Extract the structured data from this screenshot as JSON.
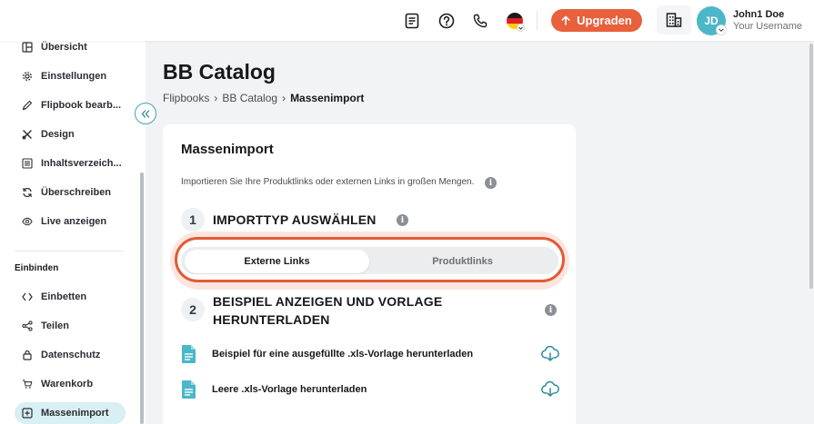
{
  "topbar": {
    "icons": [
      "document-icon",
      "help-icon",
      "phone-icon",
      "german-flag-icon"
    ],
    "upgrade_label": "Upgraden",
    "user": {
      "initials": "JD",
      "name": "John1 Doe",
      "subtitle": "Your Username"
    }
  },
  "sidebar": {
    "items": [
      {
        "label": "Übersicht",
        "icon": "overview-icon"
      },
      {
        "label": "Einstellungen",
        "icon": "gear-icon"
      },
      {
        "label": "Flipbook bearb...",
        "icon": "pencil-icon"
      },
      {
        "label": "Design",
        "icon": "design-icon"
      },
      {
        "label": "Inhaltsverzeich...",
        "icon": "list-icon"
      },
      {
        "label": "Überschreiben",
        "icon": "refresh-icon"
      },
      {
        "label": "Live anzeigen",
        "icon": "eye-icon"
      }
    ],
    "section_label": "Einbinden",
    "embed_items": [
      {
        "label": "Einbetten",
        "icon": "code-icon"
      },
      {
        "label": "Teilen",
        "icon": "share-icon"
      },
      {
        "label": "Datenschutz",
        "icon": "lock-icon"
      },
      {
        "label": "Warenkorb",
        "icon": "cart-icon"
      },
      {
        "label": "Massenimport",
        "icon": "import-icon",
        "active": true
      }
    ]
  },
  "page": {
    "title": "BB Catalog",
    "breadcrumb": [
      "Flipbooks",
      "BB Catalog",
      "Massenimport"
    ]
  },
  "card": {
    "title": "Massenimport",
    "description": "Importieren Sie Ihre Produktlinks oder externen Links in großen Mengen.",
    "step1": {
      "number": "1",
      "title": "IMPORTTYP AUSWÄHLEN"
    },
    "toggle": {
      "options": [
        "Externe Links",
        "Produktlinks"
      ],
      "selected": "Externe Links"
    },
    "step2": {
      "number": "2",
      "title_line1": "BEISPIEL ANZEIGEN UND VORLAGE",
      "title_line2": "HERUNTERLADEN"
    },
    "downloads": [
      {
        "label": "Beispiel für eine ausgefüllte .xls-Vorlage herunterladen"
      },
      {
        "label": "Leere .xls-Vorlage herunterladen"
      }
    ]
  },
  "colors": {
    "accent_orange": "#e8603c",
    "teal": "#4bb7c8",
    "highlight_outline": "#e45a36",
    "active_nav_bg": "#d8eff3"
  }
}
